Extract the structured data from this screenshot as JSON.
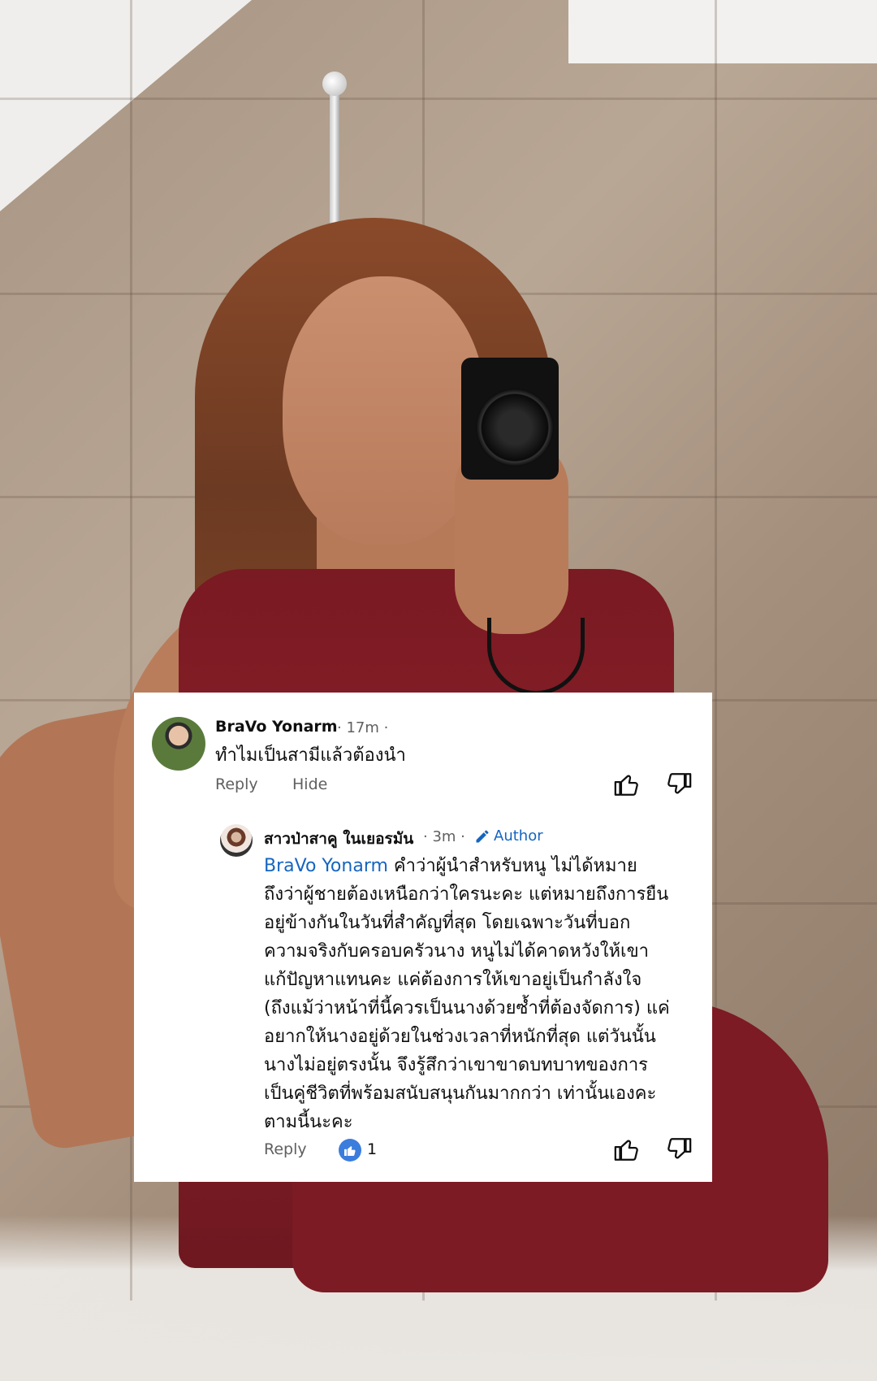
{
  "comments": [
    {
      "author": "BraVo Yonarm",
      "meta": "· 17m ·",
      "text": "ทำไมเป็นสามีแล้วต้องนำ",
      "reply_label": "Reply",
      "hide_label": "Hide"
    }
  ],
  "reply": {
    "author": "สาวป่าสาคู ในเยอรมัน",
    "meta": "· 3m ·",
    "author_badge": "Author",
    "mention": "BraVo Yonarm",
    "lines": [
      " คำว่าผู้นำสำหรับหนู ไม่ได้หมาย",
      "ถึงว่าผู้ชายต้องเหนือกว่าใครนะคะ แต่หมายถึงการยืน",
      "อยู่ข้างกันในวันที่สำคัญที่สุด โดยเฉพาะวันที่บอก",
      "ความจริงกับครอบครัวนาง หนูไม่ได้คาดหวังให้เขา",
      "แก้ปัญหาแทนคะ แค่ต้องการให้เขาอยู่เป็นกำลังใจ",
      "(ถึงแม้ว่าหน้าที่นี้ควรเป็นนางด้วยซ้ำที่ต้องจัดการ) แค่",
      "อยากให้นางอยู่ด้วยในช่วงเวลาที่หนักที่สุด แต่วันนั้น",
      "นางไม่อยู่ตรงนั้น จึงรู้สึกว่าเขาขาดบทบาทของการ",
      "เป็นคู่ชีวิตที่พร้อมสนับสนุนกันมากกว่า เท่านั้นเองคะ",
      "ตามนี้นะคะ"
    ],
    "reply_label": "Reply",
    "like_count": "1"
  },
  "icons": {
    "like": "thumbs-up-icon",
    "dislike": "thumbs-down-icon",
    "edit": "pencil-icon",
    "liked_by_author": "blue-thumbs-up-icon"
  },
  "colors": {
    "link": "#1565c0",
    "meta": "#606060",
    "text": "#0f0f0f"
  }
}
